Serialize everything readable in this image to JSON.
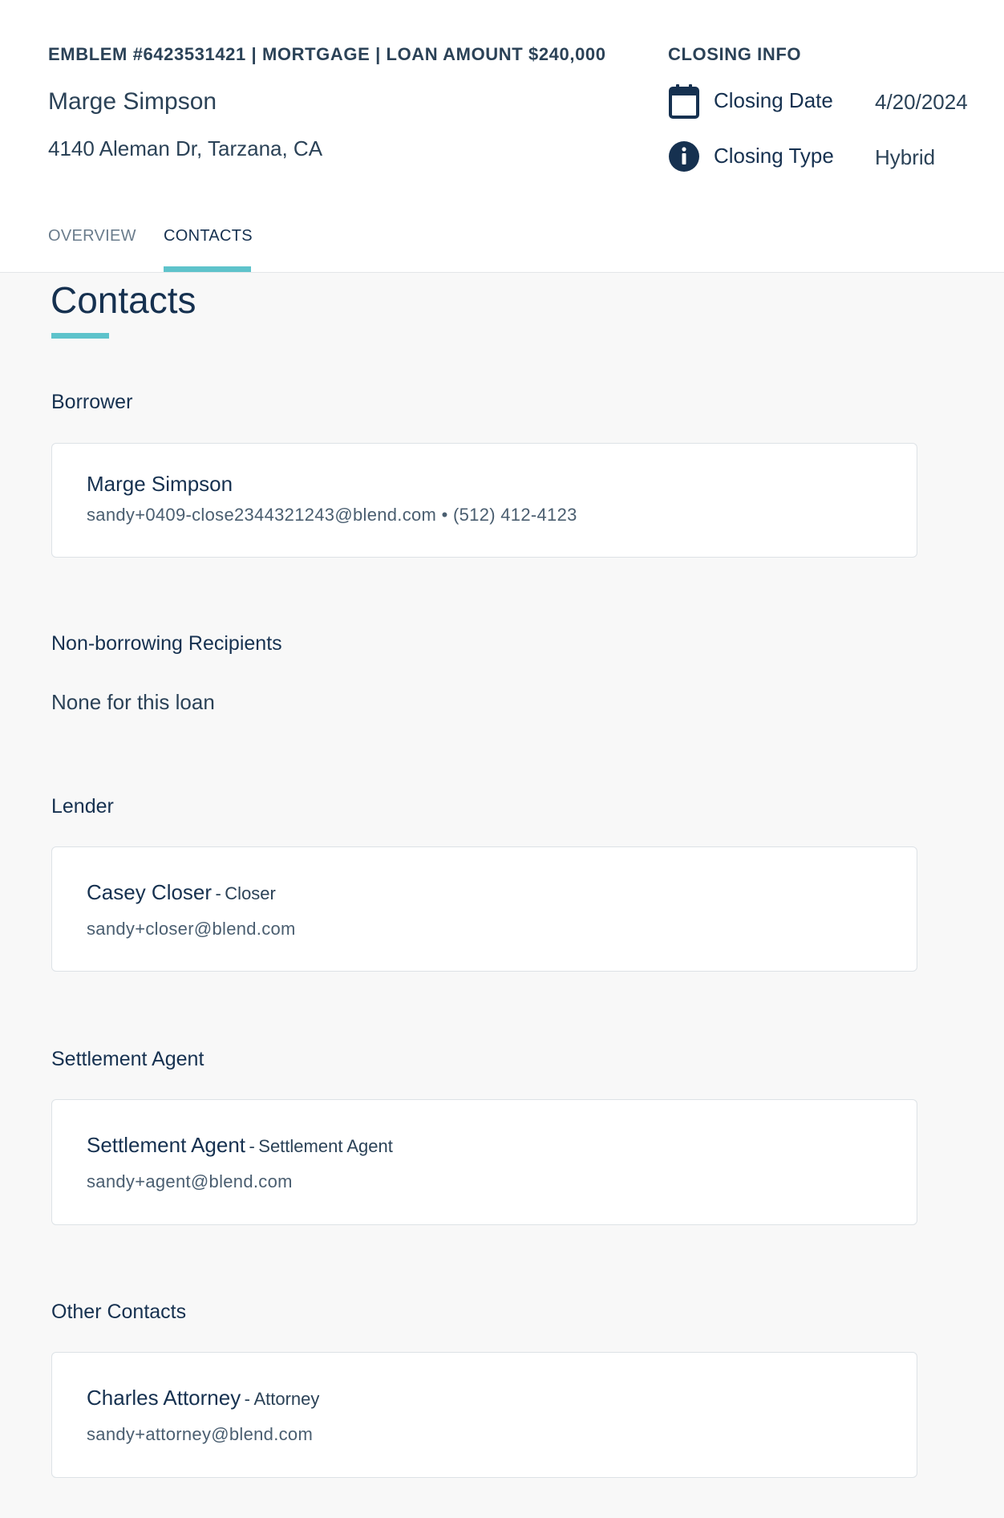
{
  "header": {
    "loan_meta": "EMBLEM #6423531421 | MORTGAGE | LOAN AMOUNT $240,000",
    "borrower_name": "Marge Simpson",
    "address": "4140 Aleman Dr, Tarzana, CA"
  },
  "closing_info": {
    "heading": "CLOSING INFO",
    "date_label": "Closing Date",
    "date_value": "4/20/2024",
    "date_icon": "calendar-icon",
    "type_label": "Closing Type",
    "type_value": "Hybrid",
    "type_icon": "info-icon"
  },
  "tabs": {
    "overview": "OVERVIEW",
    "contacts": "CONTACTS",
    "active": "contacts"
  },
  "colors": {
    "accent": "#5ec3cb",
    "navy": "#163150",
    "background": "#f8f8f8"
  },
  "page": {
    "title": "Contacts"
  },
  "sections": {
    "borrower": {
      "heading": "Borrower",
      "name": "Marge Simpson",
      "detail": "sandy+0409-close2344321243@blend.com • (512) 412-4123"
    },
    "non_borrowing": {
      "heading": "Non-borrowing Recipients",
      "empty_text": "None for this loan"
    },
    "lender": {
      "heading": "Lender",
      "name": "Casey Closer",
      "role_sep": "-",
      "role": "Closer",
      "detail": "sandy+closer@blend.com"
    },
    "settlement": {
      "heading": "Settlement Agent",
      "name": "Settlement Agent",
      "role_sep": "-",
      "role": "Settlement Agent",
      "detail": "sandy+agent@blend.com"
    },
    "other": {
      "heading": "Other Contacts",
      "name": "Charles Attorney",
      "role_sep": "-",
      "role": "Attorney",
      "detail": "sandy+attorney@blend.com"
    }
  }
}
